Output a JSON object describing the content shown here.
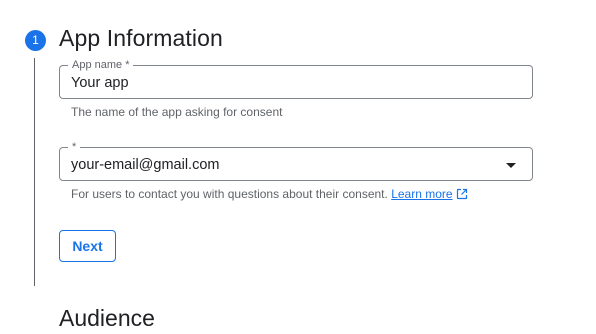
{
  "step": {
    "number": "1",
    "title": "App Information"
  },
  "app_name_field": {
    "label": "App name *",
    "value": "Your app",
    "helper": "The name of the app asking for consent"
  },
  "email_field": {
    "label": "*",
    "value": "your-email@gmail.com",
    "helper": "For users to contact you with questions about their consent.",
    "learn_more": "Learn more"
  },
  "next_button": {
    "label": "Next"
  },
  "next_step_peek": "Audience",
  "colors": {
    "accent": "#1a73e8",
    "text": "#202124",
    "secondary_text": "#5f6368",
    "border": "#80868b"
  }
}
